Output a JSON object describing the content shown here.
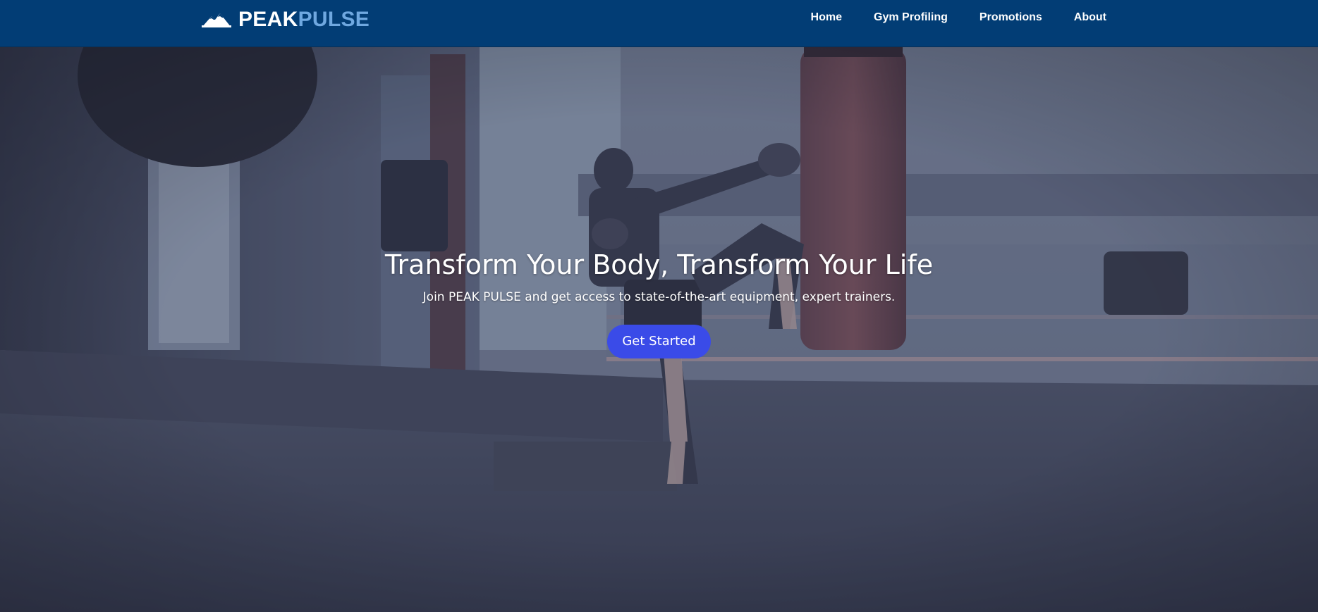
{
  "brand": {
    "name_part1": "PEAK",
    "name_part2": "PULSE",
    "logo_icon": "mountain-icon"
  },
  "nav": {
    "items": [
      {
        "label": "Home"
      },
      {
        "label": "Gym Profiling"
      },
      {
        "label": "Promotions"
      },
      {
        "label": "About"
      }
    ]
  },
  "hero": {
    "title": "Transform Your Body, Transform Your Life",
    "subtitle": "Join PEAK PULSE and get access to state-of-the-art equipment, expert trainers.",
    "cta_label": "Get Started",
    "background_image": "kickboxer-hitting-punching-bag-in-gym"
  },
  "colors": {
    "navbar": "#023d75",
    "brand_accent": "#6fa8e0",
    "cta": "#3a4be8",
    "text": "#ffffff"
  }
}
